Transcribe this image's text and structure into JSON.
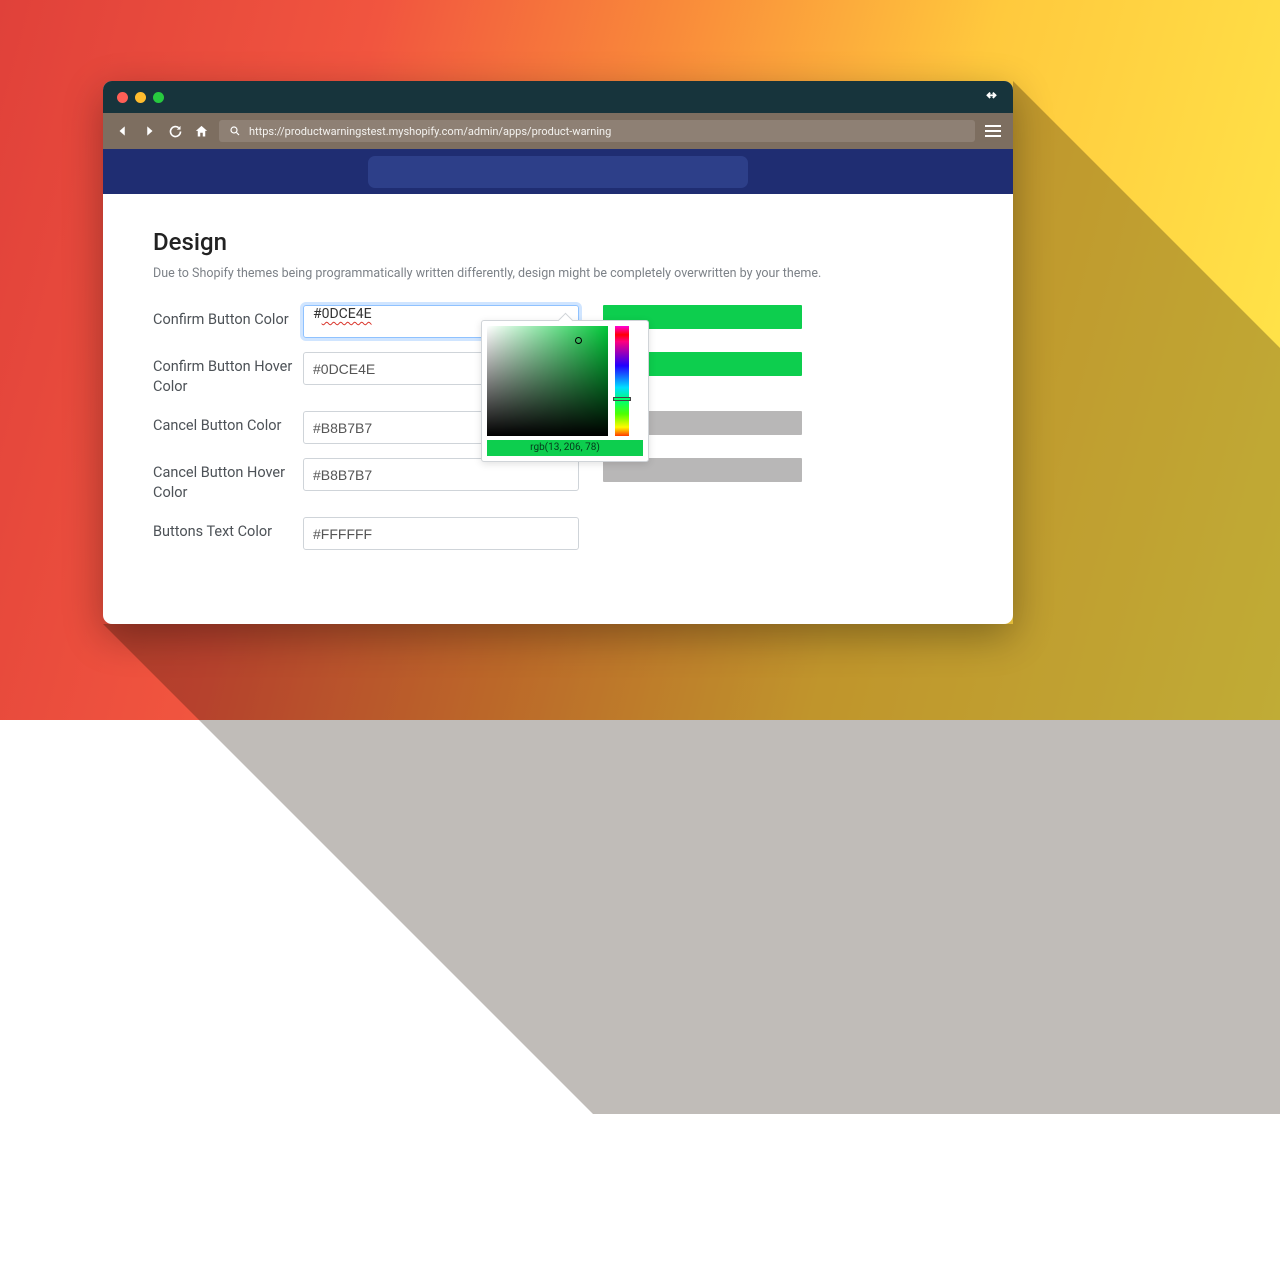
{
  "url": "https://productwarningstest.myshopify.com/admin/apps/product-warning",
  "heading": "Design",
  "subtext": "Due to Shopify themes being programmatically written differently, design might be completely overwritten by your theme.",
  "rows": {
    "confirm": {
      "label": "Confirm Button Color",
      "value": "#0DCE4E",
      "swatch": "#0dce4e"
    },
    "confirm_hover": {
      "label": "Confirm Button Hover Color",
      "value": "#0DCE4E",
      "swatch": "#0dce4e"
    },
    "cancel": {
      "label": "Cancel Button Color",
      "value": "#B8B7B7",
      "swatch": "#b8b7b7"
    },
    "cancel_hover": {
      "label": "Cancel Button Hover Color",
      "value": "#B8B7B7",
      "swatch": "#b8b7b7"
    },
    "text": {
      "label": "Buttons Text Color",
      "value": "#FFFFFF"
    }
  },
  "picker": {
    "readout": "rgb(13, 206, 78)"
  }
}
